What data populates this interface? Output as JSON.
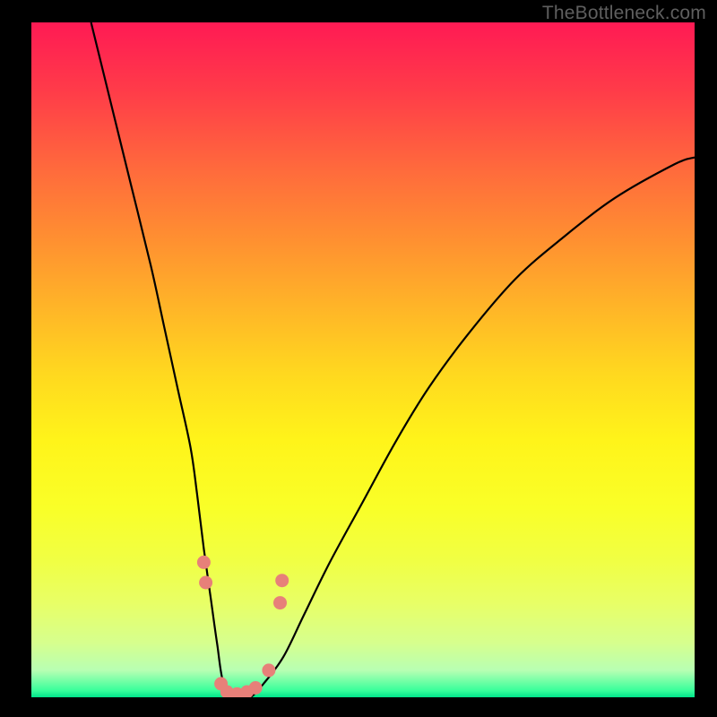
{
  "watermark": "TheBottleneck.com",
  "chart_data": {
    "type": "line",
    "title": "",
    "xlabel": "",
    "ylabel": "",
    "xlim": [
      0,
      100
    ],
    "ylim": [
      0,
      100
    ],
    "gradient_stops": [
      {
        "pos": 0,
        "color": "#ff1a54"
      },
      {
        "pos": 10,
        "color": "#ff3b49"
      },
      {
        "pos": 22,
        "color": "#ff6b3c"
      },
      {
        "pos": 32,
        "color": "#ff8f31"
      },
      {
        "pos": 42,
        "color": "#ffb428"
      },
      {
        "pos": 52,
        "color": "#ffd81f"
      },
      {
        "pos": 62,
        "color": "#fff41a"
      },
      {
        "pos": 72,
        "color": "#f9ff28"
      },
      {
        "pos": 80,
        "color": "#f0ff45"
      },
      {
        "pos": 86,
        "color": "#e8ff66"
      },
      {
        "pos": 92,
        "color": "#d6ff8e"
      },
      {
        "pos": 96,
        "color": "#b8ffb3"
      },
      {
        "pos": 99,
        "color": "#38ff9b"
      },
      {
        "pos": 100,
        "color": "#00e48b"
      }
    ],
    "series": [
      {
        "name": "curve",
        "stroke": "#000000",
        "x": [
          9,
          12,
          15,
          18,
          20,
          22,
          24,
          25,
          26,
          27,
          28,
          29,
          31,
          33,
          35,
          38,
          41,
          45,
          50,
          55,
          60,
          66,
          73,
          80,
          88,
          97,
          100
        ],
        "y": [
          100,
          88,
          76,
          64,
          55,
          46,
          37,
          30,
          22,
          15,
          8,
          2,
          0,
          0,
          2,
          6,
          12,
          20,
          29,
          38,
          46,
          54,
          62,
          68,
          74,
          79,
          80
        ]
      },
      {
        "name": "markers",
        "stroke": "#e78079",
        "points": [
          {
            "x": 26.0,
            "y": 20.0
          },
          {
            "x": 26.3,
            "y": 17.0
          },
          {
            "x": 28.6,
            "y": 2.0
          },
          {
            "x": 29.5,
            "y": 0.8
          },
          {
            "x": 31.0,
            "y": 0.5
          },
          {
            "x": 32.5,
            "y": 0.8
          },
          {
            "x": 33.8,
            "y": 1.4
          },
          {
            "x": 35.8,
            "y": 4.0
          },
          {
            "x": 37.5,
            "y": 14.0
          },
          {
            "x": 37.8,
            "y": 17.3
          }
        ]
      }
    ]
  }
}
